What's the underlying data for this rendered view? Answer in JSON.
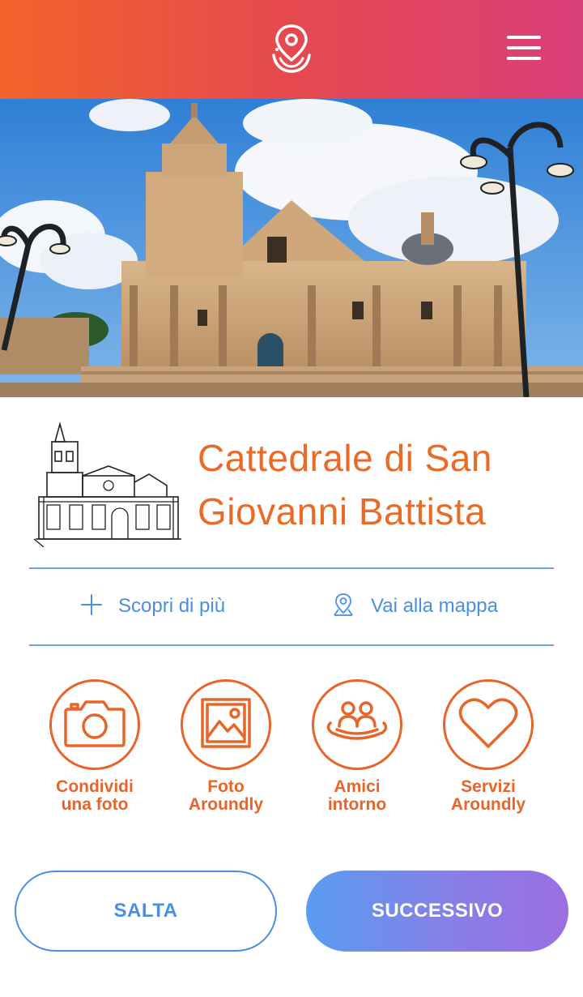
{
  "header": {
    "logo_icon": "location-pin-logo-icon",
    "menu_icon": "hamburger-menu-icon",
    "gradient_colors": [
      "#f2642a",
      "#d93f7a"
    ]
  },
  "hero": {
    "image": "photo of baroque cathedral facade with bell tower, street lamps and blue sky"
  },
  "place": {
    "sketch": "line drawing of cathedral",
    "title": "Cattedrale di San Giovanni Battista"
  },
  "actions": {
    "more": {
      "label": "Scopri di più",
      "icon": "plus-icon"
    },
    "map": {
      "label": "Vai alla mappa",
      "icon": "map-pin-icon"
    }
  },
  "features": [
    {
      "label": "Condividi\nuna foto",
      "icon": "camera-icon"
    },
    {
      "label": "Foto\nAroundly",
      "icon": "image-icon"
    },
    {
      "label": "Amici\nintorno",
      "icon": "friends-icon"
    },
    {
      "label": "Servizi\nAroundly",
      "icon": "heart-icon"
    }
  ],
  "buttons": {
    "skip": "SALTA",
    "next": "SUCCESSIVO"
  },
  "colors": {
    "accent_orange": "#ea6a28",
    "accent_blue": "#4a8fdf",
    "next_gradient": [
      "#5a9cf0",
      "#9b6fe0"
    ]
  }
}
